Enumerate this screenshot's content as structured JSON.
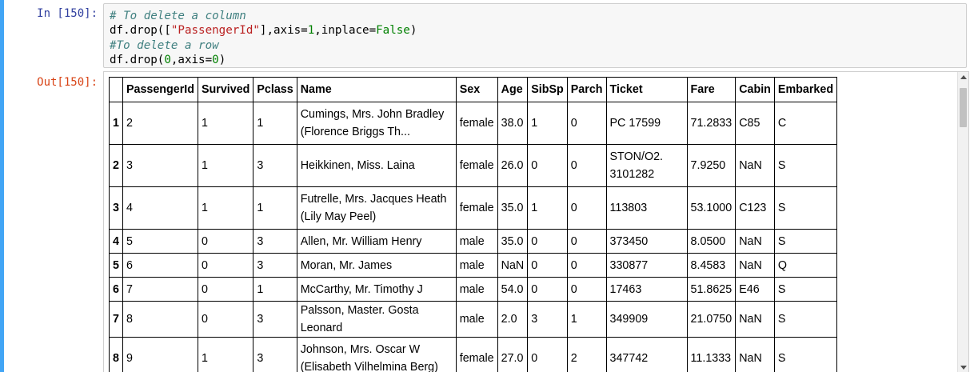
{
  "cells": {
    "input": {
      "prompt": "In [150]:",
      "lines": [
        "# To delete a column",
        "df.drop([\"PassengerId\"],axis=1,inplace=False)",
        "#To delete a row",
        "df.drop(0,axis=0)"
      ]
    },
    "output": {
      "prompt": "Out[150]:"
    }
  },
  "table": {
    "columns": [
      "",
      "PassengerId",
      "Survived",
      "Pclass",
      "Name",
      "Sex",
      "Age",
      "SibSp",
      "Parch",
      "Ticket",
      "Fare",
      "Cabin",
      "Embarked"
    ],
    "rows": [
      {
        "index": "1",
        "cells": [
          "2",
          "1",
          "1",
          "Cumings, Mrs. John Bradley (Florence Briggs Th...",
          "female",
          "38.0",
          "1",
          "0",
          "PC 17599",
          "71.2833",
          "C85",
          "C"
        ]
      },
      {
        "index": "2",
        "cells": [
          "3",
          "1",
          "3",
          "Heikkinen, Miss. Laina",
          "female",
          "26.0",
          "0",
          "0",
          "STON/O2. 3101282",
          "7.9250",
          "NaN",
          "S"
        ]
      },
      {
        "index": "3",
        "cells": [
          "4",
          "1",
          "1",
          "Futrelle, Mrs. Jacques Heath (Lily May Peel)",
          "female",
          "35.0",
          "1",
          "0",
          "113803",
          "53.1000",
          "C123",
          "S"
        ]
      },
      {
        "index": "4",
        "cells": [
          "5",
          "0",
          "3",
          "Allen, Mr. William Henry",
          "male",
          "35.0",
          "0",
          "0",
          "373450",
          "8.0500",
          "NaN",
          "S"
        ]
      },
      {
        "index": "5",
        "cells": [
          "6",
          "0",
          "3",
          "Moran, Mr. James",
          "male",
          "NaN",
          "0",
          "0",
          "330877",
          "8.4583",
          "NaN",
          "Q"
        ]
      },
      {
        "index": "6",
        "cells": [
          "7",
          "0",
          "1",
          "McCarthy, Mr. Timothy J",
          "male",
          "54.0",
          "0",
          "0",
          "17463",
          "51.8625",
          "E46",
          "S"
        ]
      },
      {
        "index": "7",
        "cells": [
          "8",
          "0",
          "3",
          "Palsson, Master. Gosta Leonard",
          "male",
          "2.0",
          "3",
          "1",
          "349909",
          "21.0750",
          "NaN",
          "S"
        ]
      },
      {
        "index": "8",
        "cells": [
          "9",
          "1",
          "3",
          "Johnson, Mrs. Oscar W (Elisabeth Vilhelmina Berg)",
          "female",
          "27.0",
          "0",
          "2",
          "347742",
          "11.1333",
          "NaN",
          "S"
        ]
      }
    ]
  },
  "colors": {
    "cell_selected_bar": "#42a5f5",
    "in_prompt": "#303f9f",
    "out_prompt": "#d84315"
  }
}
